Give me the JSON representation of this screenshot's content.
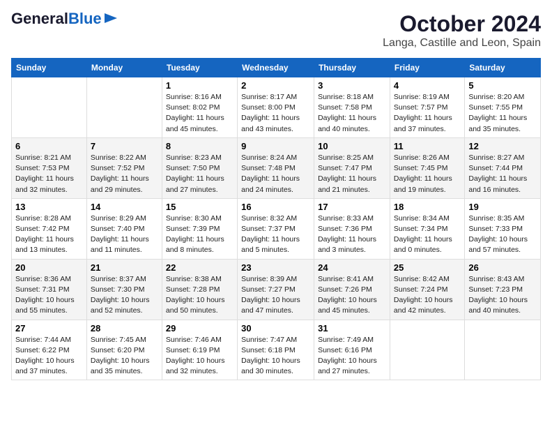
{
  "header": {
    "logo_line1": "General",
    "logo_line2": "Blue",
    "month": "October 2024",
    "location": "Langa, Castille and Leon, Spain"
  },
  "days_of_week": [
    "Sunday",
    "Monday",
    "Tuesday",
    "Wednesday",
    "Thursday",
    "Friday",
    "Saturday"
  ],
  "weeks": [
    [
      {
        "num": "",
        "sunrise": "",
        "sunset": "",
        "daylight": ""
      },
      {
        "num": "",
        "sunrise": "",
        "sunset": "",
        "daylight": ""
      },
      {
        "num": "1",
        "sunrise": "Sunrise: 8:16 AM",
        "sunset": "Sunset: 8:02 PM",
        "daylight": "Daylight: 11 hours and 45 minutes."
      },
      {
        "num": "2",
        "sunrise": "Sunrise: 8:17 AM",
        "sunset": "Sunset: 8:00 PM",
        "daylight": "Daylight: 11 hours and 43 minutes."
      },
      {
        "num": "3",
        "sunrise": "Sunrise: 8:18 AM",
        "sunset": "Sunset: 7:58 PM",
        "daylight": "Daylight: 11 hours and 40 minutes."
      },
      {
        "num": "4",
        "sunrise": "Sunrise: 8:19 AM",
        "sunset": "Sunset: 7:57 PM",
        "daylight": "Daylight: 11 hours and 37 minutes."
      },
      {
        "num": "5",
        "sunrise": "Sunrise: 8:20 AM",
        "sunset": "Sunset: 7:55 PM",
        "daylight": "Daylight: 11 hours and 35 minutes."
      }
    ],
    [
      {
        "num": "6",
        "sunrise": "Sunrise: 8:21 AM",
        "sunset": "Sunset: 7:53 PM",
        "daylight": "Daylight: 11 hours and 32 minutes."
      },
      {
        "num": "7",
        "sunrise": "Sunrise: 8:22 AM",
        "sunset": "Sunset: 7:52 PM",
        "daylight": "Daylight: 11 hours and 29 minutes."
      },
      {
        "num": "8",
        "sunrise": "Sunrise: 8:23 AM",
        "sunset": "Sunset: 7:50 PM",
        "daylight": "Daylight: 11 hours and 27 minutes."
      },
      {
        "num": "9",
        "sunrise": "Sunrise: 8:24 AM",
        "sunset": "Sunset: 7:48 PM",
        "daylight": "Daylight: 11 hours and 24 minutes."
      },
      {
        "num": "10",
        "sunrise": "Sunrise: 8:25 AM",
        "sunset": "Sunset: 7:47 PM",
        "daylight": "Daylight: 11 hours and 21 minutes."
      },
      {
        "num": "11",
        "sunrise": "Sunrise: 8:26 AM",
        "sunset": "Sunset: 7:45 PM",
        "daylight": "Daylight: 11 hours and 19 minutes."
      },
      {
        "num": "12",
        "sunrise": "Sunrise: 8:27 AM",
        "sunset": "Sunset: 7:44 PM",
        "daylight": "Daylight: 11 hours and 16 minutes."
      }
    ],
    [
      {
        "num": "13",
        "sunrise": "Sunrise: 8:28 AM",
        "sunset": "Sunset: 7:42 PM",
        "daylight": "Daylight: 11 hours and 13 minutes."
      },
      {
        "num": "14",
        "sunrise": "Sunrise: 8:29 AM",
        "sunset": "Sunset: 7:40 PM",
        "daylight": "Daylight: 11 hours and 11 minutes."
      },
      {
        "num": "15",
        "sunrise": "Sunrise: 8:30 AM",
        "sunset": "Sunset: 7:39 PM",
        "daylight": "Daylight: 11 hours and 8 minutes."
      },
      {
        "num": "16",
        "sunrise": "Sunrise: 8:32 AM",
        "sunset": "Sunset: 7:37 PM",
        "daylight": "Daylight: 11 hours and 5 minutes."
      },
      {
        "num": "17",
        "sunrise": "Sunrise: 8:33 AM",
        "sunset": "Sunset: 7:36 PM",
        "daylight": "Daylight: 11 hours and 3 minutes."
      },
      {
        "num": "18",
        "sunrise": "Sunrise: 8:34 AM",
        "sunset": "Sunset: 7:34 PM",
        "daylight": "Daylight: 11 hours and 0 minutes."
      },
      {
        "num": "19",
        "sunrise": "Sunrise: 8:35 AM",
        "sunset": "Sunset: 7:33 PM",
        "daylight": "Daylight: 10 hours and 57 minutes."
      }
    ],
    [
      {
        "num": "20",
        "sunrise": "Sunrise: 8:36 AM",
        "sunset": "Sunset: 7:31 PM",
        "daylight": "Daylight: 10 hours and 55 minutes."
      },
      {
        "num": "21",
        "sunrise": "Sunrise: 8:37 AM",
        "sunset": "Sunset: 7:30 PM",
        "daylight": "Daylight: 10 hours and 52 minutes."
      },
      {
        "num": "22",
        "sunrise": "Sunrise: 8:38 AM",
        "sunset": "Sunset: 7:28 PM",
        "daylight": "Daylight: 10 hours and 50 minutes."
      },
      {
        "num": "23",
        "sunrise": "Sunrise: 8:39 AM",
        "sunset": "Sunset: 7:27 PM",
        "daylight": "Daylight: 10 hours and 47 minutes."
      },
      {
        "num": "24",
        "sunrise": "Sunrise: 8:41 AM",
        "sunset": "Sunset: 7:26 PM",
        "daylight": "Daylight: 10 hours and 45 minutes."
      },
      {
        "num": "25",
        "sunrise": "Sunrise: 8:42 AM",
        "sunset": "Sunset: 7:24 PM",
        "daylight": "Daylight: 10 hours and 42 minutes."
      },
      {
        "num": "26",
        "sunrise": "Sunrise: 8:43 AM",
        "sunset": "Sunset: 7:23 PM",
        "daylight": "Daylight: 10 hours and 40 minutes."
      }
    ],
    [
      {
        "num": "27",
        "sunrise": "Sunrise: 7:44 AM",
        "sunset": "Sunset: 6:22 PM",
        "daylight": "Daylight: 10 hours and 37 minutes."
      },
      {
        "num": "28",
        "sunrise": "Sunrise: 7:45 AM",
        "sunset": "Sunset: 6:20 PM",
        "daylight": "Daylight: 10 hours and 35 minutes."
      },
      {
        "num": "29",
        "sunrise": "Sunrise: 7:46 AM",
        "sunset": "Sunset: 6:19 PM",
        "daylight": "Daylight: 10 hours and 32 minutes."
      },
      {
        "num": "30",
        "sunrise": "Sunrise: 7:47 AM",
        "sunset": "Sunset: 6:18 PM",
        "daylight": "Daylight: 10 hours and 30 minutes."
      },
      {
        "num": "31",
        "sunrise": "Sunrise: 7:49 AM",
        "sunset": "Sunset: 6:16 PM",
        "daylight": "Daylight: 10 hours and 27 minutes."
      },
      {
        "num": "",
        "sunrise": "",
        "sunset": "",
        "daylight": ""
      },
      {
        "num": "",
        "sunrise": "",
        "sunset": "",
        "daylight": ""
      }
    ]
  ]
}
